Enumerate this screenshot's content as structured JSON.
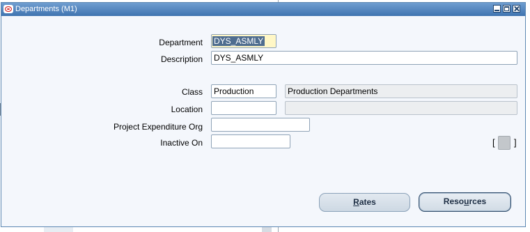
{
  "window": {
    "title": "Departments (M1)"
  },
  "form": {
    "department": {
      "label": "Department",
      "value": "DYS_ASMLY"
    },
    "description": {
      "label": "Description",
      "value": "DYS_ASMLY"
    },
    "class": {
      "label": "Class",
      "value": "Production",
      "description": "Production Departments"
    },
    "location": {
      "label": "Location",
      "value": "",
      "description": ""
    },
    "project_expenditure_org": {
      "label": "Project Expenditure Org",
      "value": ""
    },
    "inactive_on": {
      "label": "Inactive On",
      "value": ""
    }
  },
  "indicator": {
    "left_bracket": "[",
    "right_bracket": "]"
  },
  "buttons": {
    "rates": {
      "mnemonic": "R",
      "rest": "ates"
    },
    "resources": {
      "before": "Reso",
      "mnemonic": "u",
      "after": "rces"
    }
  },
  "colors": {
    "title_bar": "#3f74b0",
    "window_background": "#f4f7fc",
    "active_field": "#fff7c6",
    "selection": "#4f6d8f"
  }
}
